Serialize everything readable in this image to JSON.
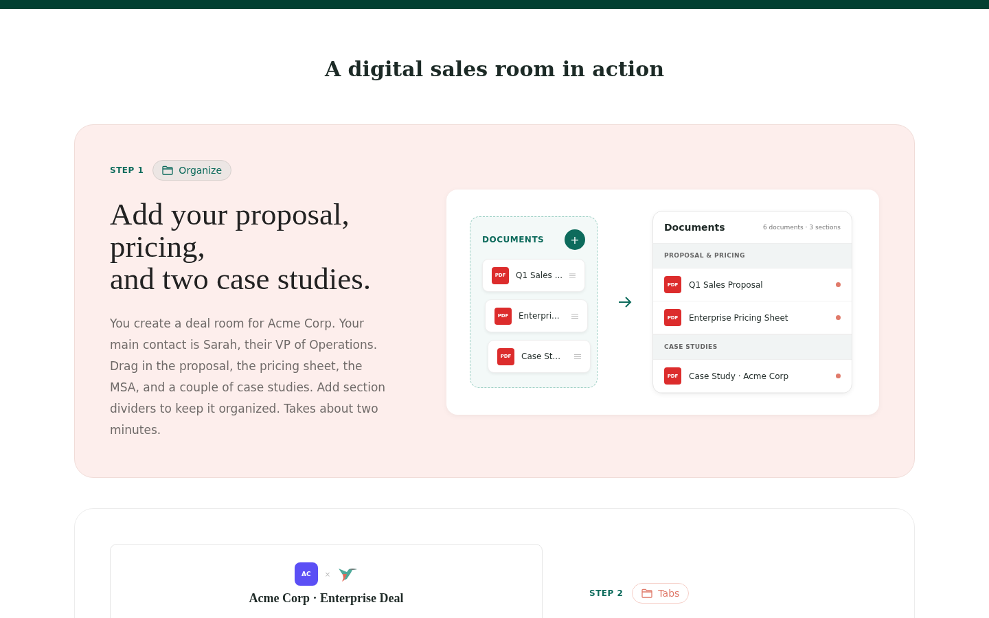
{
  "heading": "A digital sales room in action",
  "steps": [
    {
      "label": "STEP 1",
      "tag": "Organize",
      "title_lines": [
        "Add your proposal,",
        "pricing,",
        "and two case studies."
      ],
      "body": "You create a deal room for Acme Corp. Your main contact is Sarah, their VP of Operations. Drag in the proposal, the pricing sheet, the MSA, and a couple of case studies. Add section dividers to keep it organized. Takes about two minutes.",
      "demo": {
        "uploader": {
          "title": "DOCUMENTS",
          "add": "+",
          "files": [
            {
              "badge": "PDF",
              "name": "Q1 Sales ..."
            },
            {
              "badge": "PDF",
              "name": "Enterpri..."
            },
            {
              "badge": "PDF",
              "name": "Case St..."
            }
          ]
        },
        "list": {
          "title": "Documents",
          "meta": "6 documents · 3 sections",
          "sections": [
            {
              "name": "PROPOSAL & PRICING",
              "items": [
                {
                  "badge": "PDF",
                  "name": "Q1 Sales Proposal",
                  "color": "#e07a6a"
                },
                {
                  "badge": "PDF",
                  "name": "Enterprise Pricing Sheet",
                  "color": "#e07a6a"
                }
              ]
            },
            {
              "name": "CASE STUDIES",
              "items": [
                {
                  "badge": "PDF",
                  "name": "Case Study · Acme Corp",
                  "color": "#e07a6a"
                }
              ]
            }
          ]
        }
      }
    },
    {
      "label": "STEP 2",
      "tag": "Tabs",
      "preview": {
        "avatar": "AC",
        "separator": "×",
        "title": "Acme Corp · Enterprise Deal"
      }
    }
  ]
}
